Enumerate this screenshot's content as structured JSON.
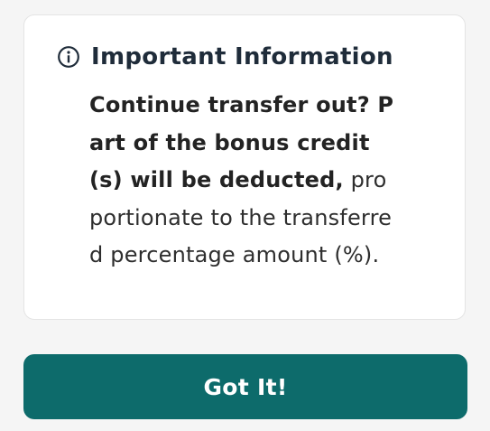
{
  "card": {
    "title": "Important Information",
    "message_bold": "Continue transfer out? Part of the bonus credit(s) will be deducted,",
    "message_rest": " proportionate to the transferred percentage amount (%)."
  },
  "actions": {
    "confirm_label": "Got It!"
  },
  "icons": {
    "header": "info-circle-icon"
  },
  "colors": {
    "accent": "#0d6b6b",
    "background": "#f5f5f5",
    "card": "#ffffff",
    "title": "#1f2c3a",
    "button_text": "#ffffff"
  }
}
